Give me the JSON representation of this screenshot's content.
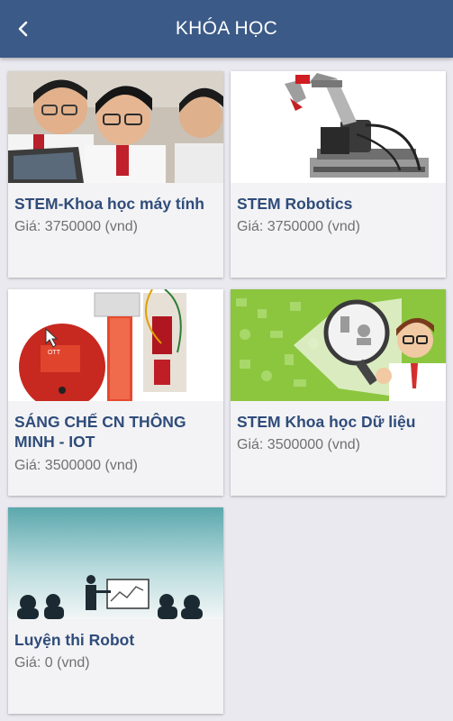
{
  "header": {
    "title": "KHÓA HỌC",
    "back_icon": "back-arrow-icon"
  },
  "courses": [
    {
      "title": "STEM-Khoa học máy tính",
      "price": "Giá: 3750000 (vnd)",
      "image": "students-laptop-photo"
    },
    {
      "title": "STEM Robotics",
      "price": "Giá: 3750000 (vnd)",
      "image": "robot-arm-photo"
    },
    {
      "title": "SÁNG CHẾ CN THÔNG MINH - IOT",
      "price": "Giá: 3500000 (vnd)",
      "image": "electronics-breadboard-photo"
    },
    {
      "title": "STEM Khoa học Dữ liệu",
      "price": "Giá: 3500000 (vnd)",
      "image": "data-science-illustration"
    },
    {
      "title": "Luyện thi Robot",
      "price": "Giá: 0 (vnd)",
      "image": "presentation-silhouettes-illustration"
    }
  ],
  "colors": {
    "appbar": "#3b5a88",
    "background": "#e9e9ef",
    "card": "#f3f3f5",
    "title_text": "#2f4c7a",
    "price_text": "#707070"
  }
}
